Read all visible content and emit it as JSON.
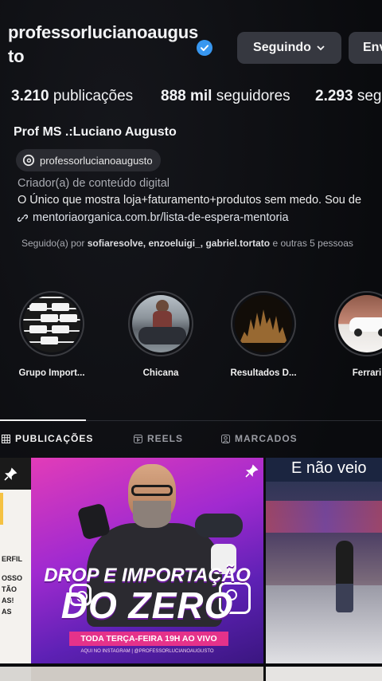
{
  "profile": {
    "username": "professorlucianoaugusto",
    "follow_button": "Seguindo",
    "message_button": "Enviar",
    "stats": {
      "posts_count": "3.210",
      "posts_label": "publicações",
      "followers_count": "888 mil",
      "followers_label": "seguidores",
      "following_count": "2.293",
      "following_label": "seguindo"
    },
    "full_name": "Prof MS .:Luciano Augusto",
    "threads_handle": "professorlucianoaugusto",
    "category": "Criador(a) de conteúdo digital",
    "bio": "O Único que mostra loja+faturamento+produtos sem medo. Sou de",
    "link": "mentoriaorganica.com.br/lista-de-espera-mentoria",
    "followed_by_prefix": "Seguido(a) por",
    "followed_by_names": "sofiaresolve, enzoeluigi_, gabriel.tortato",
    "followed_by_suffix": "e outras 5 pessoas"
  },
  "highlights": [
    {
      "label": "Grupo Import..."
    },
    {
      "label": "Chicana"
    },
    {
      "label": "Resultados D..."
    },
    {
      "label": "Ferrari"
    }
  ],
  "tabs": [
    {
      "label": "PUBLICAÇÕES",
      "active": true,
      "icon": "grid-icon"
    },
    {
      "label": "REELS",
      "active": false,
      "icon": "reels-icon"
    },
    {
      "label": "MARCADOS",
      "active": false,
      "icon": "tagged-icon"
    }
  ],
  "posts": {
    "left": {
      "lines": [
        "ERFIL",
        "OSSO",
        "TÃO",
        "AS!",
        "AS"
      ]
    },
    "middle": {
      "title_line1": "DROP E IMPORTAÇÃO",
      "title_line2": "DO ZERO",
      "schedule": "TODA TERÇA-FEIRA 19H AO VIVO",
      "fine_print": "AQUI NO INSTAGRAM | @PROFESSORLUCIANOAUGUSTO"
    },
    "right": {
      "caption": "E não veio"
    }
  },
  "colors": {
    "background": "#0b0c10",
    "button": "#363840",
    "verified": "#3897f0",
    "promo_magenta": "#e23cb8",
    "promo_bar": "#e5328a"
  }
}
